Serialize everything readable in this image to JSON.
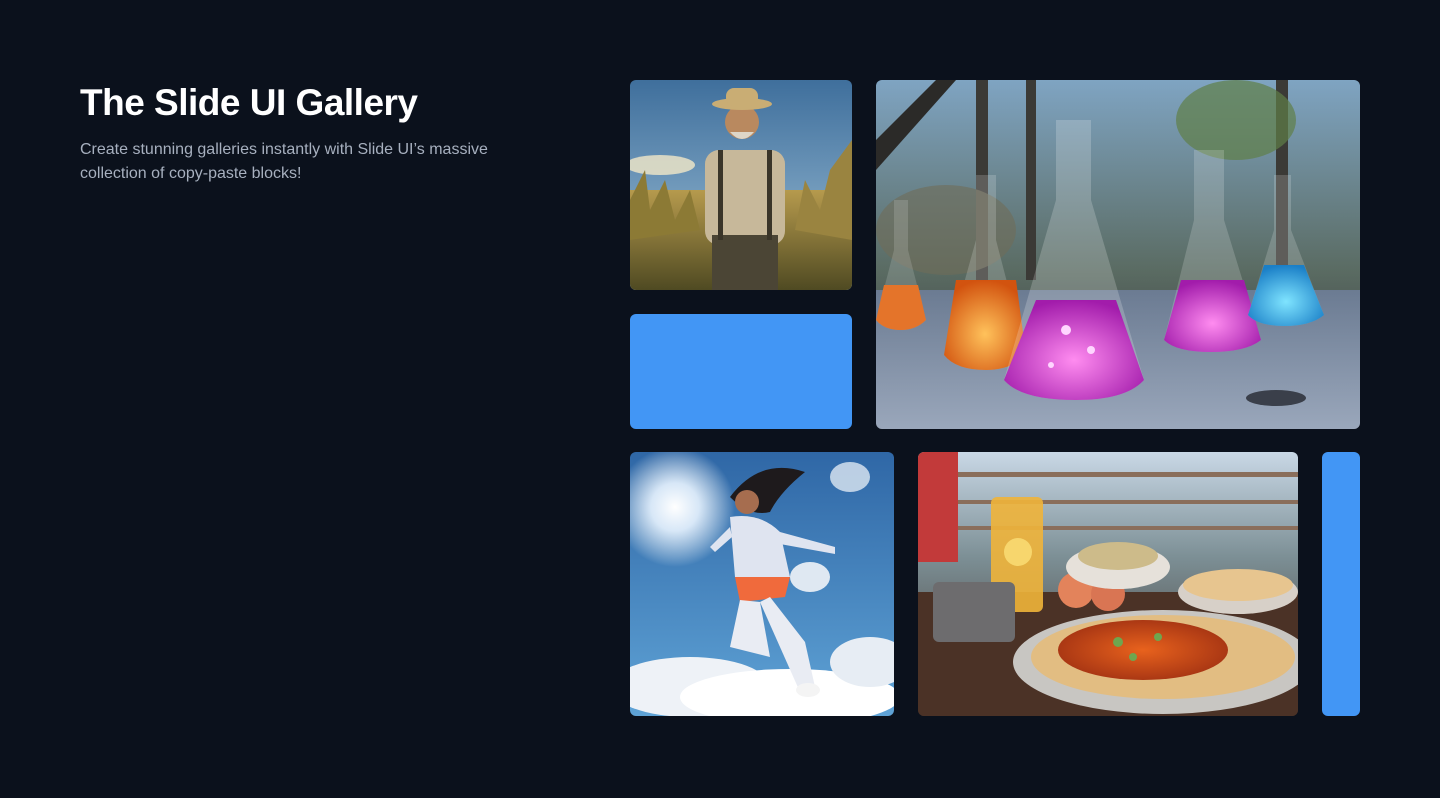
{
  "header": {
    "title": "The Slide UI Gallery",
    "subtitle": "Create stunning galleries instantly with Slide UI’s massive collection of copy-paste blocks!"
  },
  "gallery": {
    "accent_color": "#4296f5",
    "images": [
      {
        "id": "farmer",
        "icon": "farmer-photo"
      },
      {
        "id": "flasks",
        "icon": "lab-flasks-photo"
      },
      {
        "id": "jumper",
        "icon": "jumping-woman-photo"
      },
      {
        "id": "food",
        "icon": "curry-naan-photo"
      }
    ]
  }
}
